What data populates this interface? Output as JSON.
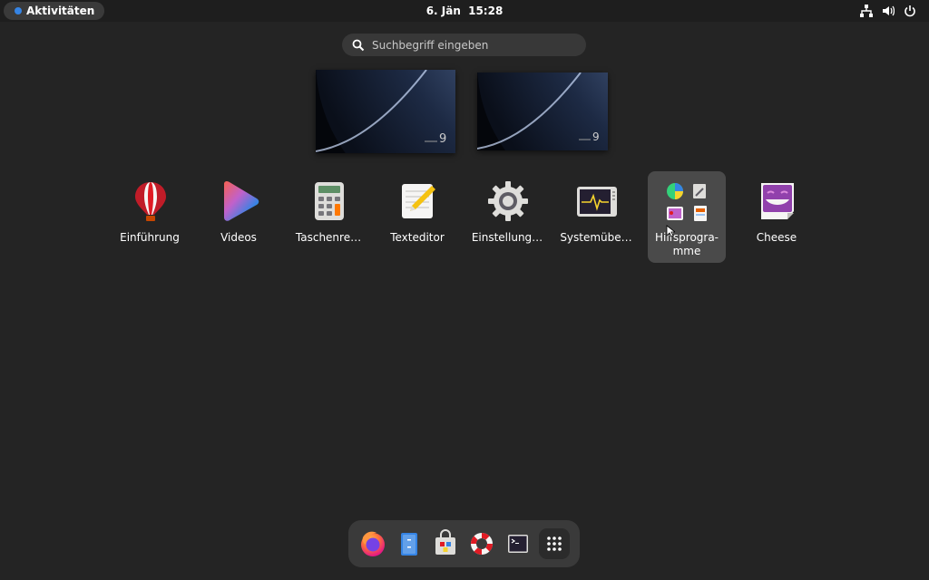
{
  "topbar": {
    "activities_label": "Aktivitäten",
    "date": "6. Jän",
    "time": "15:28"
  },
  "search": {
    "placeholder": "Suchbegriff eingeben"
  },
  "workspaces": [
    {
      "badge": "9"
    },
    {
      "badge": "9"
    }
  ],
  "apps": [
    {
      "label": "Einführung",
      "icon": "hot-air-balloon-icon"
    },
    {
      "label": "Videos",
      "icon": "videos-play-icon"
    },
    {
      "label": "Taschenre…",
      "icon": "calculator-icon"
    },
    {
      "label": "Texteditor",
      "icon": "text-editor-icon"
    },
    {
      "label": "Einstellung…",
      "icon": "settings-gear-icon"
    },
    {
      "label": "Systemübe…",
      "icon": "system-monitor-icon"
    },
    {
      "label": "Hilfsprogra-mme",
      "icon": "utilities-folder-icon"
    },
    {
      "label": "Cheese",
      "icon": "cheese-icon"
    }
  ],
  "dash": [
    {
      "name": "firefox",
      "icon": "firefox-icon"
    },
    {
      "name": "files",
      "icon": "files-icon"
    },
    {
      "name": "software",
      "icon": "software-store-icon"
    },
    {
      "name": "help",
      "icon": "help-lifebuoy-icon"
    },
    {
      "name": "terminal",
      "icon": "terminal-icon"
    },
    {
      "name": "show-apps",
      "icon": "app-grid-icon"
    }
  ],
  "colors": {
    "accent": "#3584e4",
    "background": "#242424",
    "topbar": "#1e1e1e"
  }
}
